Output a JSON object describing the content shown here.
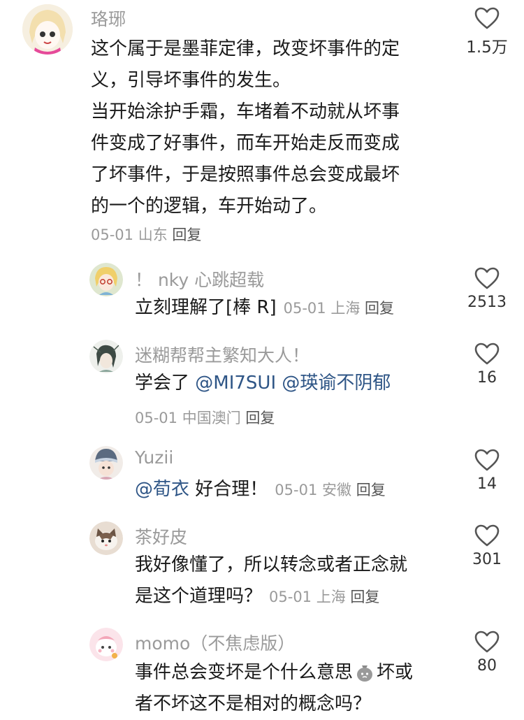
{
  "comments": [
    {
      "user": "珞琊",
      "lines": [
        "这个属于是墨菲定律，改变坏事件的定",
        "义，引导坏事件的发生。",
        "当开始涂护手霜，车堵着不动就从坏事",
        "件变成了好事件，而车开始走反而变成",
        "了坏事件，于是按照事件总会变成最坏",
        "的一个的逻辑，车开始动了。"
      ],
      "date": "05-01",
      "location": "山东",
      "reply": "回复",
      "likes": "1.5万"
    }
  ],
  "replies": [
    {
      "user": "！ nky 心跳超载",
      "text": "立刻理解了[棒 R]",
      "date": "05-01",
      "location": "上海",
      "reply": "回复",
      "likes": "2513"
    },
    {
      "user": "迷糊帮帮主繁知大人！",
      "text_prefix": "学会了",
      "mention1": "@MI7SUI",
      "mention2": "@瑛谕不阴郁",
      "date": "05-01",
      "location": "中国澳门",
      "reply": "回复",
      "likes": "16"
    },
    {
      "user": "Yuzii",
      "mention": "@荀衣",
      "text": "好合理！",
      "date": "05-01",
      "location": "安徽",
      "reply": "回复",
      "likes": "14"
    },
    {
      "user": "茶好皮",
      "line1": "我好像懂了，所以转念或者正念就",
      "line2": "是这个道理吗？",
      "date": "05-01",
      "location": "上海",
      "reply": "回复",
      "likes": "301"
    },
    {
      "user": "momo（不焦虑版）",
      "line1a": "事件总会变坏是个什么意思",
      "line1b": "坏或",
      "line2": "者不坏这不是相对的概念吗？",
      "likes": "80"
    }
  ]
}
